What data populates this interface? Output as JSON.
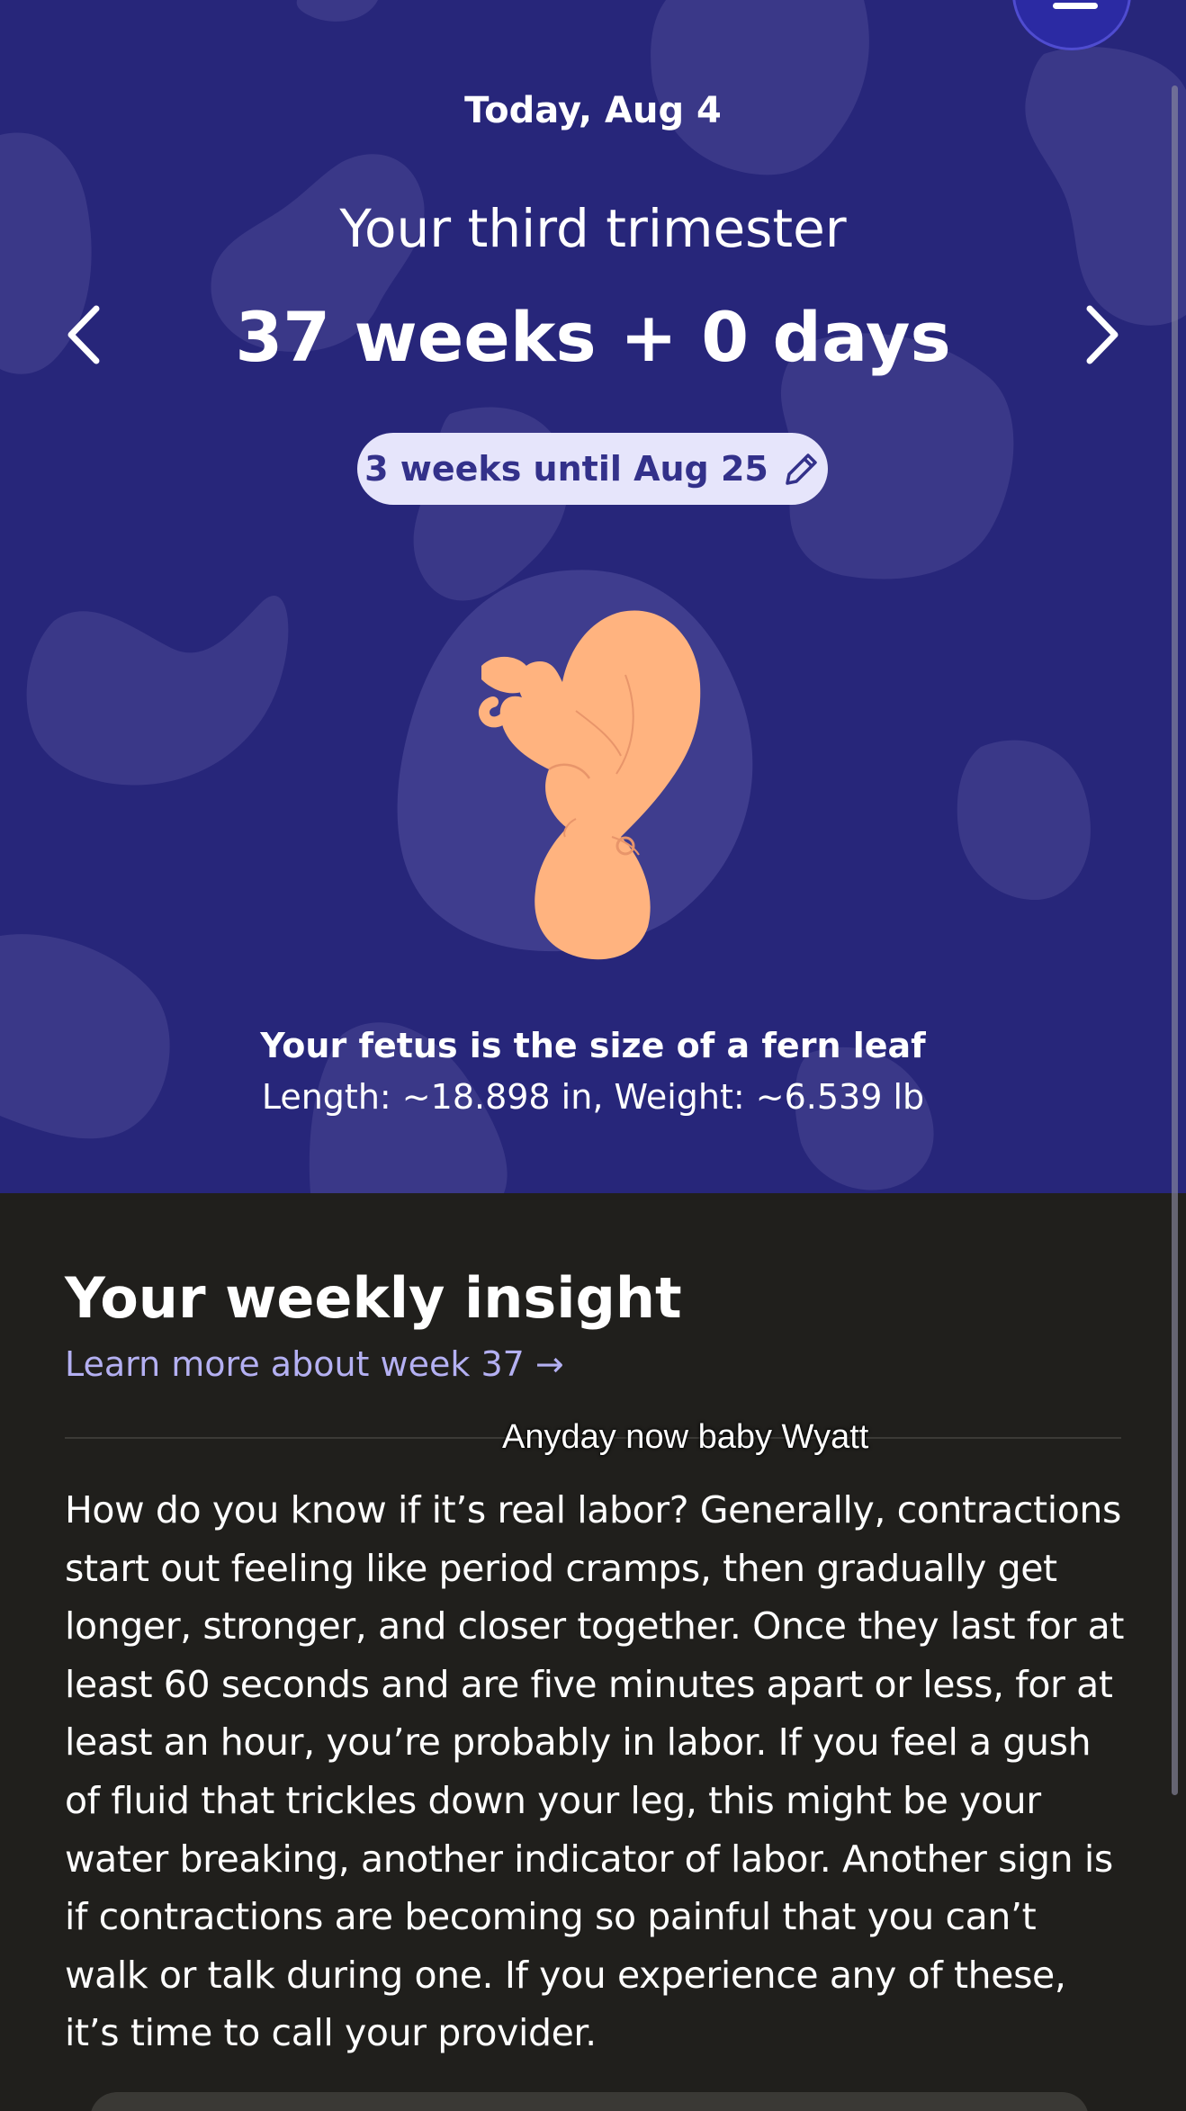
{
  "header": {
    "date_label": "Today, Aug 4",
    "trimester": "Your third trimester",
    "pregnancy_age": "37 weeks + 0 days",
    "due_pill": "3 weeks until Aug 25"
  },
  "fetus": {
    "size_title": "Your fetus is the size of a fern leaf",
    "size_detail": "Length: ~18.898 in, Weight: ~6.539 lb"
  },
  "insight": {
    "title": "Your weekly insight",
    "link": "Learn more about week 37 →",
    "caption": "Anyday now baby Wyatt",
    "body": "How do you know if it’s real labor? Generally, contractions start out feeling like period cramps, then gradually get longer, stronger, and closer together. Once they last for at least 60 seconds and are five minutes apart or less, for at least an hour, you’re probably in labor. If you feel a gush of fluid that trickles down your leg, this might be your water breaking, another indicator of labor. Another sign is if contractions are becoming so painful that you can’t walk or talk during one. If you experience any of these, it’s time to call your provider."
  },
  "colors": {
    "hero_bg": "#27267a",
    "blob": "#3a3888",
    "pill_bg": "#e6e5fb",
    "pill_text": "#33318a",
    "link": "#b4b0f2",
    "section_bg": "#201f1c",
    "fetus_skin": "#ffb37f"
  },
  "icons": {
    "prev": "chevron-left-icon",
    "next": "chevron-right-icon",
    "edit": "pencil-icon",
    "menu": "menu-icon"
  }
}
